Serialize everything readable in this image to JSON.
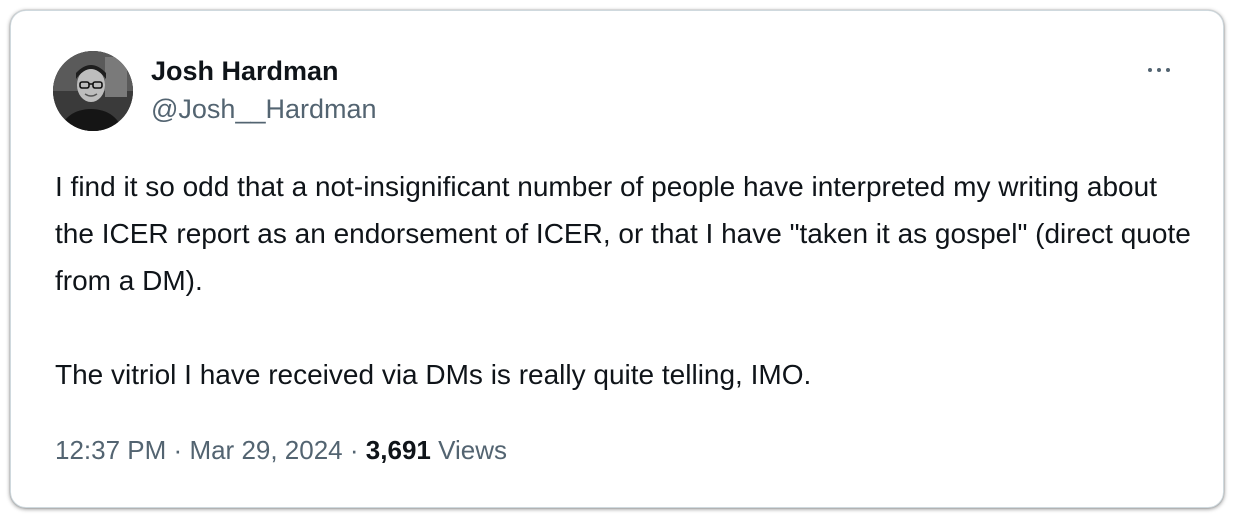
{
  "author": {
    "display_name": "Josh Hardman",
    "handle": "@Josh__Hardman",
    "avatar_icon": "profile-photo"
  },
  "more_icon": "ellipsis-icon",
  "tweet": {
    "paragraphs": [
      "I find it so odd that a not-insignificant number of people have interpreted my writing about the ICER report as an endorsement of ICER, or that I have \"taken it as gospel\" (direct quote from a DM).",
      "The vitriol I have received via DMs is really quite telling, IMO."
    ]
  },
  "meta": {
    "time": "12:37 PM",
    "separator": "·",
    "date": "Mar 29, 2024",
    "views_count": "3,691",
    "views_label": "Views"
  },
  "colors": {
    "text_primary": "#0f1419",
    "text_secondary": "#536471",
    "border": "#cfd9de"
  }
}
